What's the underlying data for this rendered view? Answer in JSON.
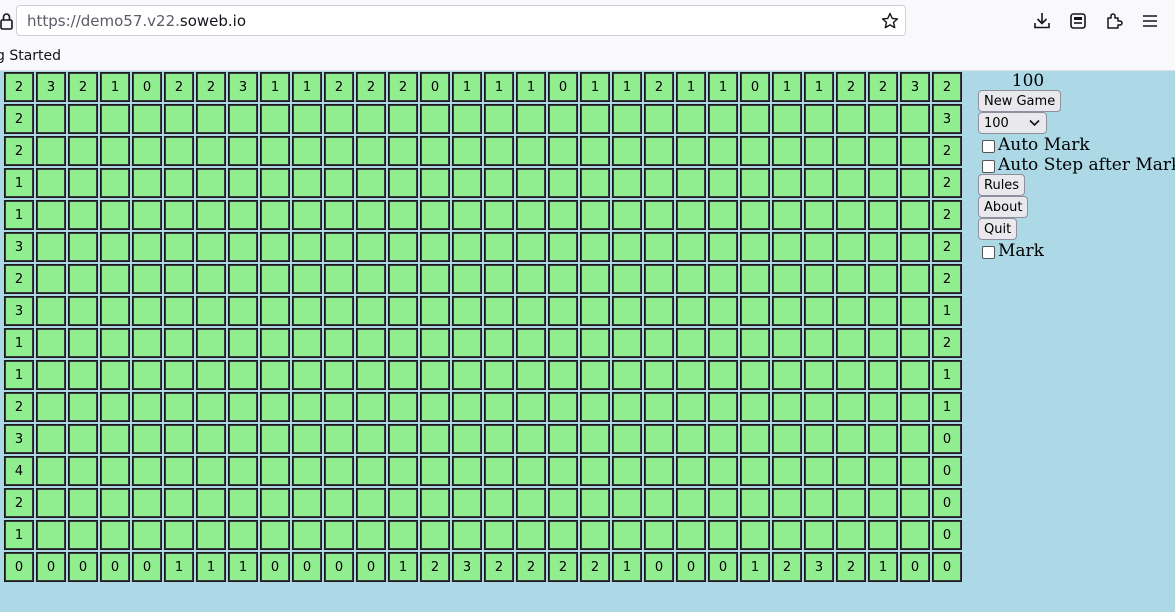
{
  "browser": {
    "url_prefix": "https://demo57.v22.",
    "url_host": "soweb.io",
    "bookmark_label": "g Started"
  },
  "game": {
    "mine_count": "100",
    "new_game_label": "New Game",
    "size_select_value": "100",
    "auto_mark_label": "Auto Mark",
    "auto_step_label": "Auto Step after Mark",
    "rules_label": "Rules",
    "about_label": "About",
    "quit_label": "Quit",
    "mark_label": "Mark"
  },
  "board": {
    "columns": 30,
    "rows": [
      [
        "2",
        "3",
        "2",
        "1",
        "0",
        "2",
        "2",
        "3",
        "1",
        "1",
        "2",
        "2",
        "2",
        "0",
        "1",
        "1",
        "1",
        "0",
        "1",
        "1",
        "2",
        "1",
        "1",
        "0",
        "1",
        "1",
        "2",
        "2",
        "3",
        "2"
      ],
      [
        "2",
        "",
        "",
        "",
        "",
        "",
        "",
        "",
        "",
        "",
        "",
        "",
        "",
        "",
        "",
        "",
        "",
        "",
        "",
        "",
        "",
        "",
        "",
        "",
        "",
        "",
        "",
        "",
        "",
        "3"
      ],
      [
        "2",
        "",
        "",
        "",
        "",
        "",
        "",
        "",
        "",
        "",
        "",
        "",
        "",
        "",
        "",
        "",
        "",
        "",
        "",
        "",
        "",
        "",
        "",
        "",
        "",
        "",
        "",
        "",
        "",
        "2"
      ],
      [
        "1",
        "",
        "",
        "",
        "",
        "",
        "",
        "",
        "",
        "",
        "",
        "",
        "",
        "",
        "",
        "",
        "",
        "",
        "",
        "",
        "",
        "",
        "",
        "",
        "",
        "",
        "",
        "",
        "",
        "2"
      ],
      [
        "1",
        "",
        "",
        "",
        "",
        "",
        "",
        "",
        "",
        "",
        "",
        "",
        "",
        "",
        "",
        "",
        "",
        "",
        "",
        "",
        "",
        "",
        "",
        "",
        "",
        "",
        "",
        "",
        "",
        "2"
      ],
      [
        "3",
        "",
        "",
        "",
        "",
        "",
        "",
        "",
        "",
        "",
        "",
        "",
        "",
        "",
        "",
        "",
        "",
        "",
        "",
        "",
        "",
        "",
        "",
        "",
        "",
        "",
        "",
        "",
        "",
        "2"
      ],
      [
        "2",
        "",
        "",
        "",
        "",
        "",
        "",
        "",
        "",
        "",
        "",
        "",
        "",
        "",
        "",
        "",
        "",
        "",
        "",
        "",
        "",
        "",
        "",
        "",
        "",
        "",
        "",
        "",
        "",
        "2"
      ],
      [
        "3",
        "",
        "",
        "",
        "",
        "",
        "",
        "",
        "",
        "",
        "",
        "",
        "",
        "",
        "",
        "",
        "",
        "",
        "",
        "",
        "",
        "",
        "",
        "",
        "",
        "",
        "",
        "",
        "",
        "1"
      ],
      [
        "1",
        "",
        "",
        "",
        "",
        "",
        "",
        "",
        "",
        "",
        "",
        "",
        "",
        "",
        "",
        "",
        "",
        "",
        "",
        "",
        "",
        "",
        "",
        "",
        "",
        "",
        "",
        "",
        "",
        "2"
      ],
      [
        "1",
        "",
        "",
        "",
        "",
        "",
        "",
        "",
        "",
        "",
        "",
        "",
        "",
        "",
        "",
        "",
        "",
        "",
        "",
        "",
        "",
        "",
        "",
        "",
        "",
        "",
        "",
        "",
        "",
        "1"
      ],
      [
        "2",
        "",
        "",
        "",
        "",
        "",
        "",
        "",
        "",
        "",
        "",
        "",
        "",
        "",
        "",
        "",
        "",
        "",
        "",
        "",
        "",
        "",
        "",
        "",
        "",
        "",
        "",
        "",
        "",
        "1"
      ],
      [
        "3",
        "",
        "",
        "",
        "",
        "",
        "",
        "",
        "",
        "",
        "",
        "",
        "",
        "",
        "",
        "",
        "",
        "",
        "",
        "",
        "",
        "",
        "",
        "",
        "",
        "",
        "",
        "",
        "",
        "0"
      ],
      [
        "4",
        "",
        "",
        "",
        "",
        "",
        "",
        "",
        "",
        "",
        "",
        "",
        "",
        "",
        "",
        "",
        "",
        "",
        "",
        "",
        "",
        "",
        "",
        "",
        "",
        "",
        "",
        "",
        "",
        "0"
      ],
      [
        "2",
        "",
        "",
        "",
        "",
        "",
        "",
        "",
        "",
        "",
        "",
        "",
        "",
        "",
        "",
        "",
        "",
        "",
        "",
        "",
        "",
        "",
        "",
        "",
        "",
        "",
        "",
        "",
        "",
        "0"
      ],
      [
        "1",
        "",
        "",
        "",
        "",
        "",
        "",
        "",
        "",
        "",
        "",
        "",
        "",
        "",
        "",
        "",
        "",
        "",
        "",
        "",
        "",
        "",
        "",
        "",
        "",
        "",
        "",
        "",
        "",
        "0"
      ],
      [
        "0",
        "0",
        "0",
        "0",
        "0",
        "1",
        "1",
        "1",
        "0",
        "0",
        "0",
        "0",
        "1",
        "2",
        "3",
        "2",
        "2",
        "2",
        "2",
        "1",
        "0",
        "0",
        "0",
        "1",
        "2",
        "3",
        "2",
        "1",
        "0",
        "0"
      ]
    ]
  },
  "icons": {
    "lock": "lock-icon",
    "star": "star-icon",
    "download": "download-icon",
    "pocket": "pocket-icon",
    "extensions": "extensions-icon",
    "menu": "menu-icon"
  },
  "colors": {
    "page_background": "#add8e6",
    "cell_background": "#90ee90"
  }
}
